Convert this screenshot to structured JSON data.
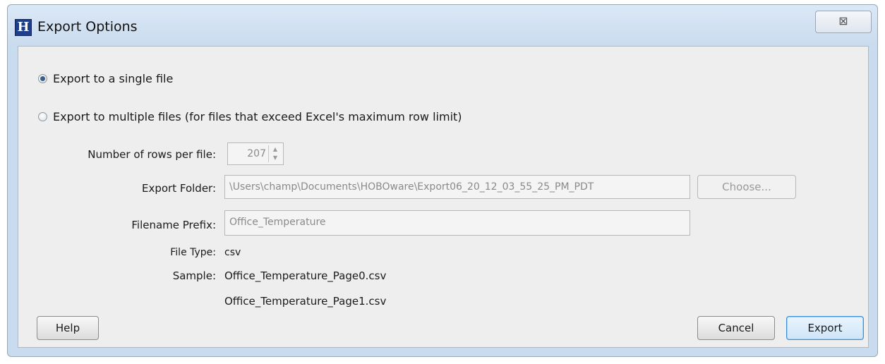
{
  "window": {
    "title": "Export Options",
    "app_icon": "H",
    "close_glyph": "⊠"
  },
  "options": {
    "single_file_label": "Export to a single file",
    "multiple_files_label": "Export to multiple files (for files that exceed Excel's maximum row limit)",
    "selected": "single"
  },
  "form": {
    "rows_label": "Number of rows per file:",
    "rows_value": "207",
    "folder_label": "Export Folder:",
    "folder_value": "\\Users\\champ\\Documents\\HOBOware\\Export06_20_12_03_55_25_PM_PDT",
    "choose_label": "Choose...",
    "prefix_label": "Filename Prefix:",
    "prefix_value": "Office_Temperature",
    "filetype_label": "File Type:",
    "filetype_value": "csv",
    "sample_label": "Sample:",
    "sample_files": [
      "Office_Temperature_Page0.csv",
      "Office_Temperature_Page1.csv"
    ]
  },
  "buttons": {
    "help": "Help",
    "cancel": "Cancel",
    "export": "Export"
  }
}
